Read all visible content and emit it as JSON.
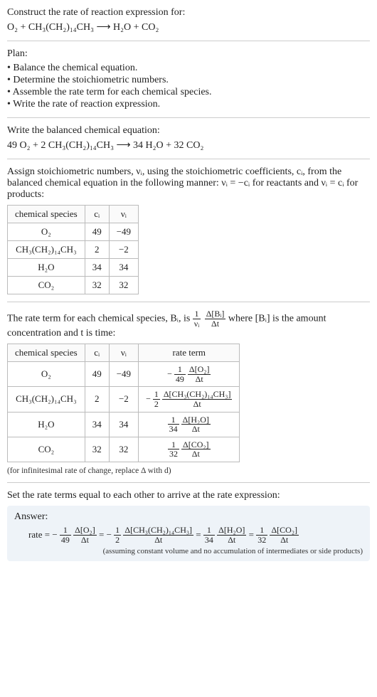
{
  "intro": {
    "title": "Construct the rate of reaction expression for:",
    "equation": "O₂ + CH₃(CH₂)₁₄CH₃  ⟶  H₂O + CO₂"
  },
  "plan": {
    "heading": "Plan:",
    "items": [
      "• Balance the chemical equation.",
      "• Determine the stoichiometric numbers.",
      "• Assemble the rate term for each chemical species.",
      "• Write the rate of reaction expression."
    ]
  },
  "balanced": {
    "heading": "Write the balanced chemical equation:",
    "equation": "49 O₂ + 2 CH₃(CH₂)₁₄CH₃  ⟶  34 H₂O + 32 CO₂"
  },
  "assign": {
    "text": "Assign stoichiometric numbers, νᵢ, using the stoichiometric coefficients, cᵢ, from the balanced chemical equation in the following manner: νᵢ = −cᵢ for reactants and νᵢ = cᵢ for products:",
    "headers": [
      "chemical species",
      "cᵢ",
      "νᵢ"
    ],
    "rows": [
      {
        "sp": "O₂",
        "c": "49",
        "v": "−49"
      },
      {
        "sp": "CH₃(CH₂)₁₄CH₃",
        "c": "2",
        "v": "−2"
      },
      {
        "sp": "H₂O",
        "c": "34",
        "v": "34"
      },
      {
        "sp": "CO₂",
        "c": "32",
        "v": "32"
      }
    ]
  },
  "rateterm": {
    "text_before": "The rate term for each chemical species, Bᵢ, is ",
    "frac_top": "1",
    "frac_bot": "νᵢ",
    "frac2_top": "Δ[Bᵢ]",
    "frac2_bot": "Δt",
    "text_after": " where [Bᵢ] is the amount concentration and t is time:",
    "headers": [
      "chemical species",
      "cᵢ",
      "νᵢ",
      "rate term"
    ],
    "rows": [
      {
        "sp": "O₂",
        "c": "49",
        "v": "−49",
        "sign": "−",
        "d": "49",
        "num": "Δ[O₂]"
      },
      {
        "sp": "CH₃(CH₂)₁₄CH₃",
        "c": "2",
        "v": "−2",
        "sign": "−",
        "d": "2",
        "num": "Δ[CH₃(CH₂)₁₄CH₃]"
      },
      {
        "sp": "H₂O",
        "c": "34",
        "v": "34",
        "sign": "",
        "d": "34",
        "num": "Δ[H₂O]"
      },
      {
        "sp": "CO₂",
        "c": "32",
        "v": "32",
        "sign": "",
        "d": "32",
        "num": "Δ[CO₂]"
      }
    ],
    "note": "(for infinitesimal rate of change, replace Δ with d)"
  },
  "final": {
    "heading": "Set the rate terms equal to each other to arrive at the rate expression:",
    "answer_label": "Answer:",
    "rate_word": "rate = ",
    "terms": [
      {
        "sign": "−",
        "d": "49",
        "num": "Δ[O₂]"
      },
      {
        "sign": "−",
        "d": "2",
        "num": "Δ[CH₃(CH₂)₁₄CH₃]"
      },
      {
        "sign": "",
        "d": "34",
        "num": "Δ[H₂O]"
      },
      {
        "sign": "",
        "d": "32",
        "num": "Δ[CO₂]"
      }
    ],
    "note": "(assuming constant volume and no accumulation of intermediates or side products)"
  },
  "dt": "Δt",
  "eq": " = "
}
